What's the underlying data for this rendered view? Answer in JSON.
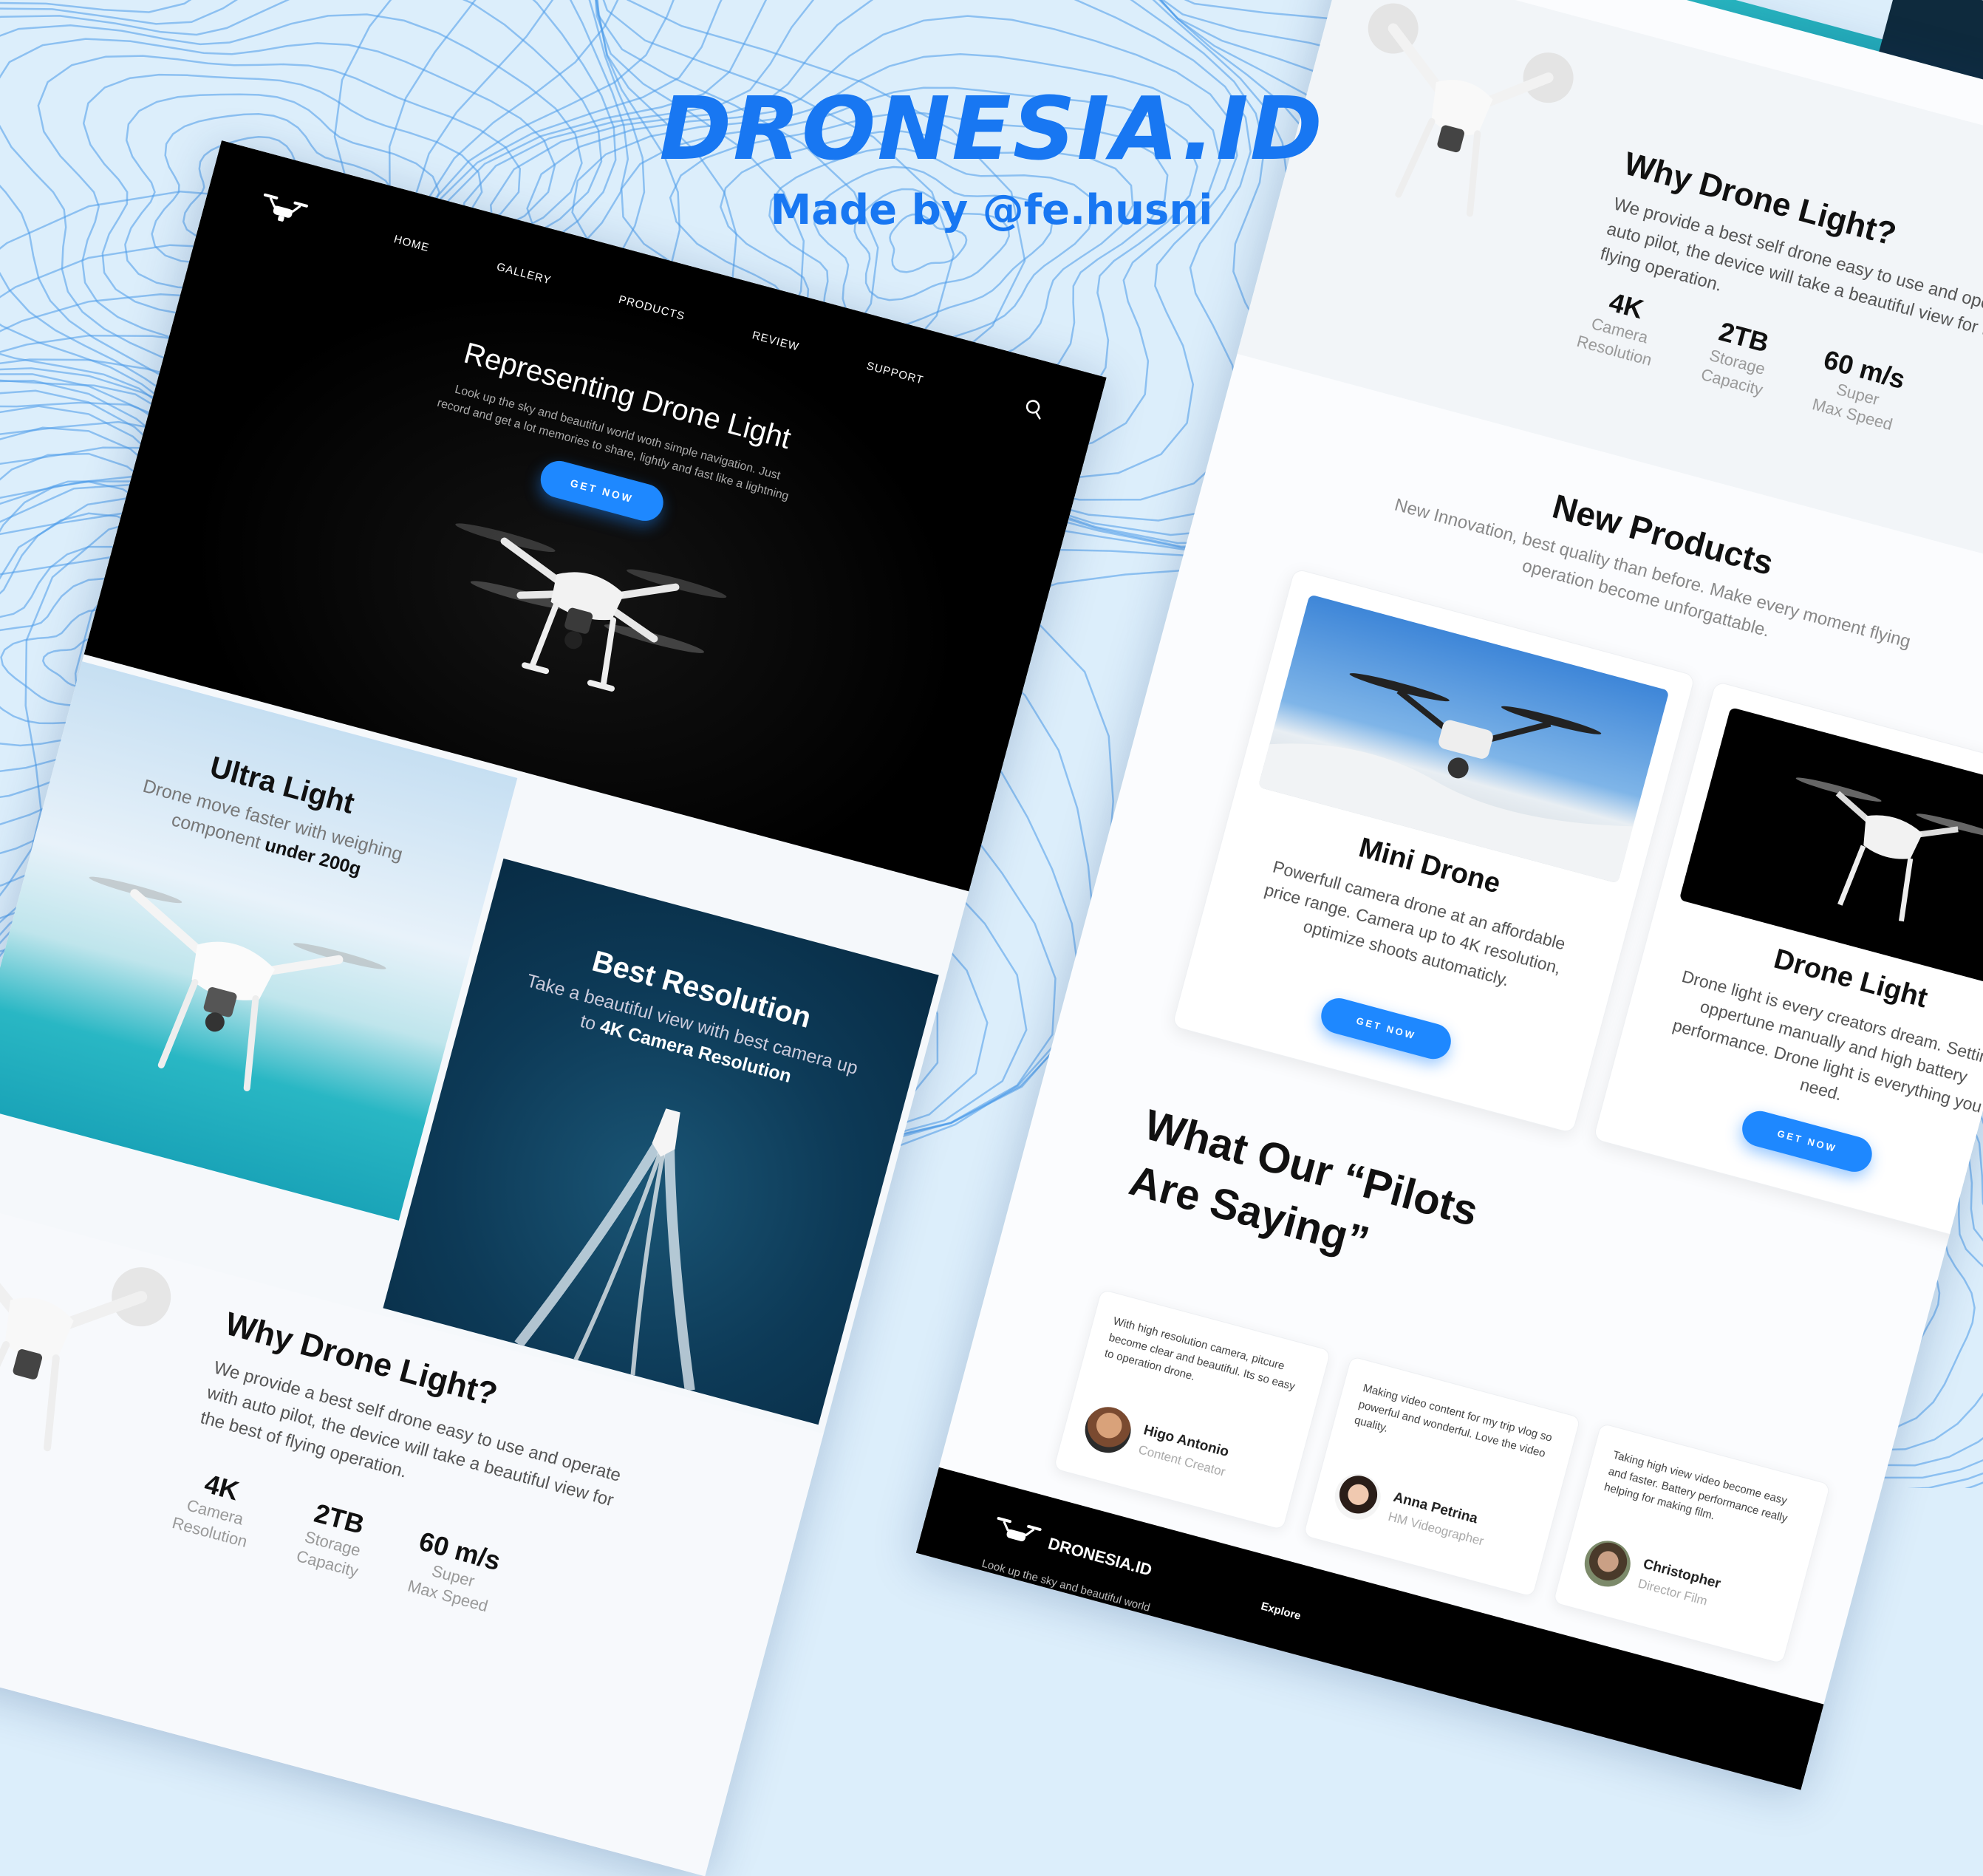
{
  "brand": {
    "title": "DRONESIA.ID",
    "subtitle": "Made by @fe.husni"
  },
  "colors": {
    "accent": "#1e88ff",
    "brand_blue": "#1877f2",
    "hero_bg": "#000000",
    "background": "#dceefb",
    "contour": "#4a9bea"
  },
  "nav": {
    "items": [
      "HOME",
      "GALLERY",
      "PRODUCTS",
      "REVIEW",
      "SUPPORT"
    ],
    "search_icon": "search-icon",
    "logo_icon": "drone-logo-icon"
  },
  "hero": {
    "title": "Representing Drone Light",
    "description": "Look up the sky and beautiful  world woth simple navigation. Just record and get a lot memories to share, lightly and fast like a lightning",
    "button": "GET NOW"
  },
  "features": [
    {
      "title": "Ultra Light",
      "text": "Drone move faster with weighing component",
      "emphasis": "under 200g"
    },
    {
      "title": "Best Resolution",
      "text": "Take a beautiful view with best camera up to",
      "emphasis": "4K Camera Resolution"
    }
  ],
  "why": {
    "title": "Why Drone Light?",
    "text": "We provide a best self drone easy to use and operate with auto pilot, the device will take a beautiful view for the best of flying operation.",
    "stats": [
      {
        "value": "4K",
        "label1": "Camera",
        "label2": "Resolution"
      },
      {
        "value": "2TB",
        "label1": "Storage",
        "label2": "Capacity"
      },
      {
        "value": "60 m/s",
        "label1": "Super",
        "label2": "Max Speed"
      }
    ]
  },
  "products": {
    "title": "New Products",
    "subtitle": "New Innovation, best quality than before. Make every moment flying operation become unforgattable.",
    "items": [
      {
        "name": "Mini Drone",
        "description": "Powerfull camera drone at an affordable price range. Camera up to 4K resolution, optimize shoots automaticly.",
        "button": "GET NOW"
      },
      {
        "name": "Drone Light",
        "description": "Drone light is every creators dream. Setting oppertune manually and high battery performance. Drone light is everything you need.",
        "button": "GET NOW"
      }
    ]
  },
  "testimonials": {
    "title_line1": "What Our “Pilots",
    "title_line2": "Are Saying”",
    "items": [
      {
        "quote": "With high resolution camera, pitcure become clear and beautiful. Its so easy to operation drone.",
        "name": "Higo Antonio",
        "role": "Content Creator"
      },
      {
        "quote": "Making video content for my trip vlog so powerful and wonderful. Love the video quality.",
        "name": "Anna Petrina",
        "role": "HM Videographer"
      },
      {
        "quote": "Taking high view video become easy and faster. Battery performance really helping for making film.",
        "name": "Christopher",
        "role": "Director Film"
      }
    ]
  },
  "footer": {
    "name": "DRONESIA.ID",
    "description": "Look up the sky and beautiful world easily.",
    "explore": "Explore"
  }
}
